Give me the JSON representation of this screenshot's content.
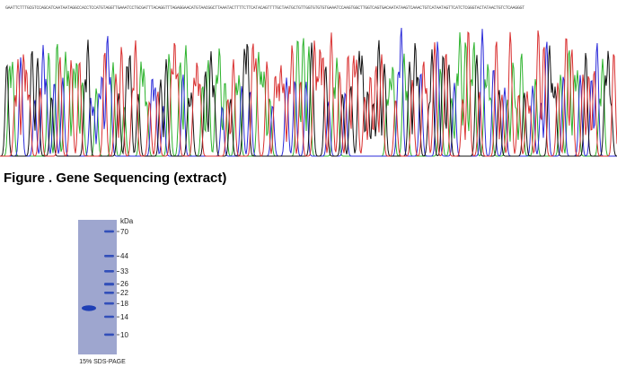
{
  "sequence": {
    "bases": "GAATTCTTTGCGTCCAGCATCAATAATAGGCCACCTCCATGTAGGTTGAAATCCTGCGATTTACAGGTTTAGAGGAACATGTAACGGCTTAAATACTTTTCTTCATACAGTTTTGCTAATGCTGTTGGTGTGTGTGAAATCCAAGTGGCTTGGTCAGTGACAATATAAGTCAAACTGTCATAATAGTTCATCTCGGGTACTATAACTGTCTCAAGGGT",
    "colors": {
      "A": "#2db32d",
      "C": "#2b2bd9",
      "G": "#111111",
      "T": "#d93030"
    }
  },
  "caption": "Figure . Gene Sequencing (extract)",
  "gel": {
    "unit_label": "kDa",
    "markers": [
      "70",
      "44",
      "33",
      "26",
      "22",
      "18",
      "14",
      "10"
    ],
    "marker_kda": [
      70,
      44,
      33,
      26,
      22,
      18,
      14,
      10
    ],
    "sample_band_kda": 16.5,
    "caption": "15% SDS-PAGE",
    "colors": {
      "background": "#9ea6cf",
      "band": "#1f3fb5"
    }
  }
}
